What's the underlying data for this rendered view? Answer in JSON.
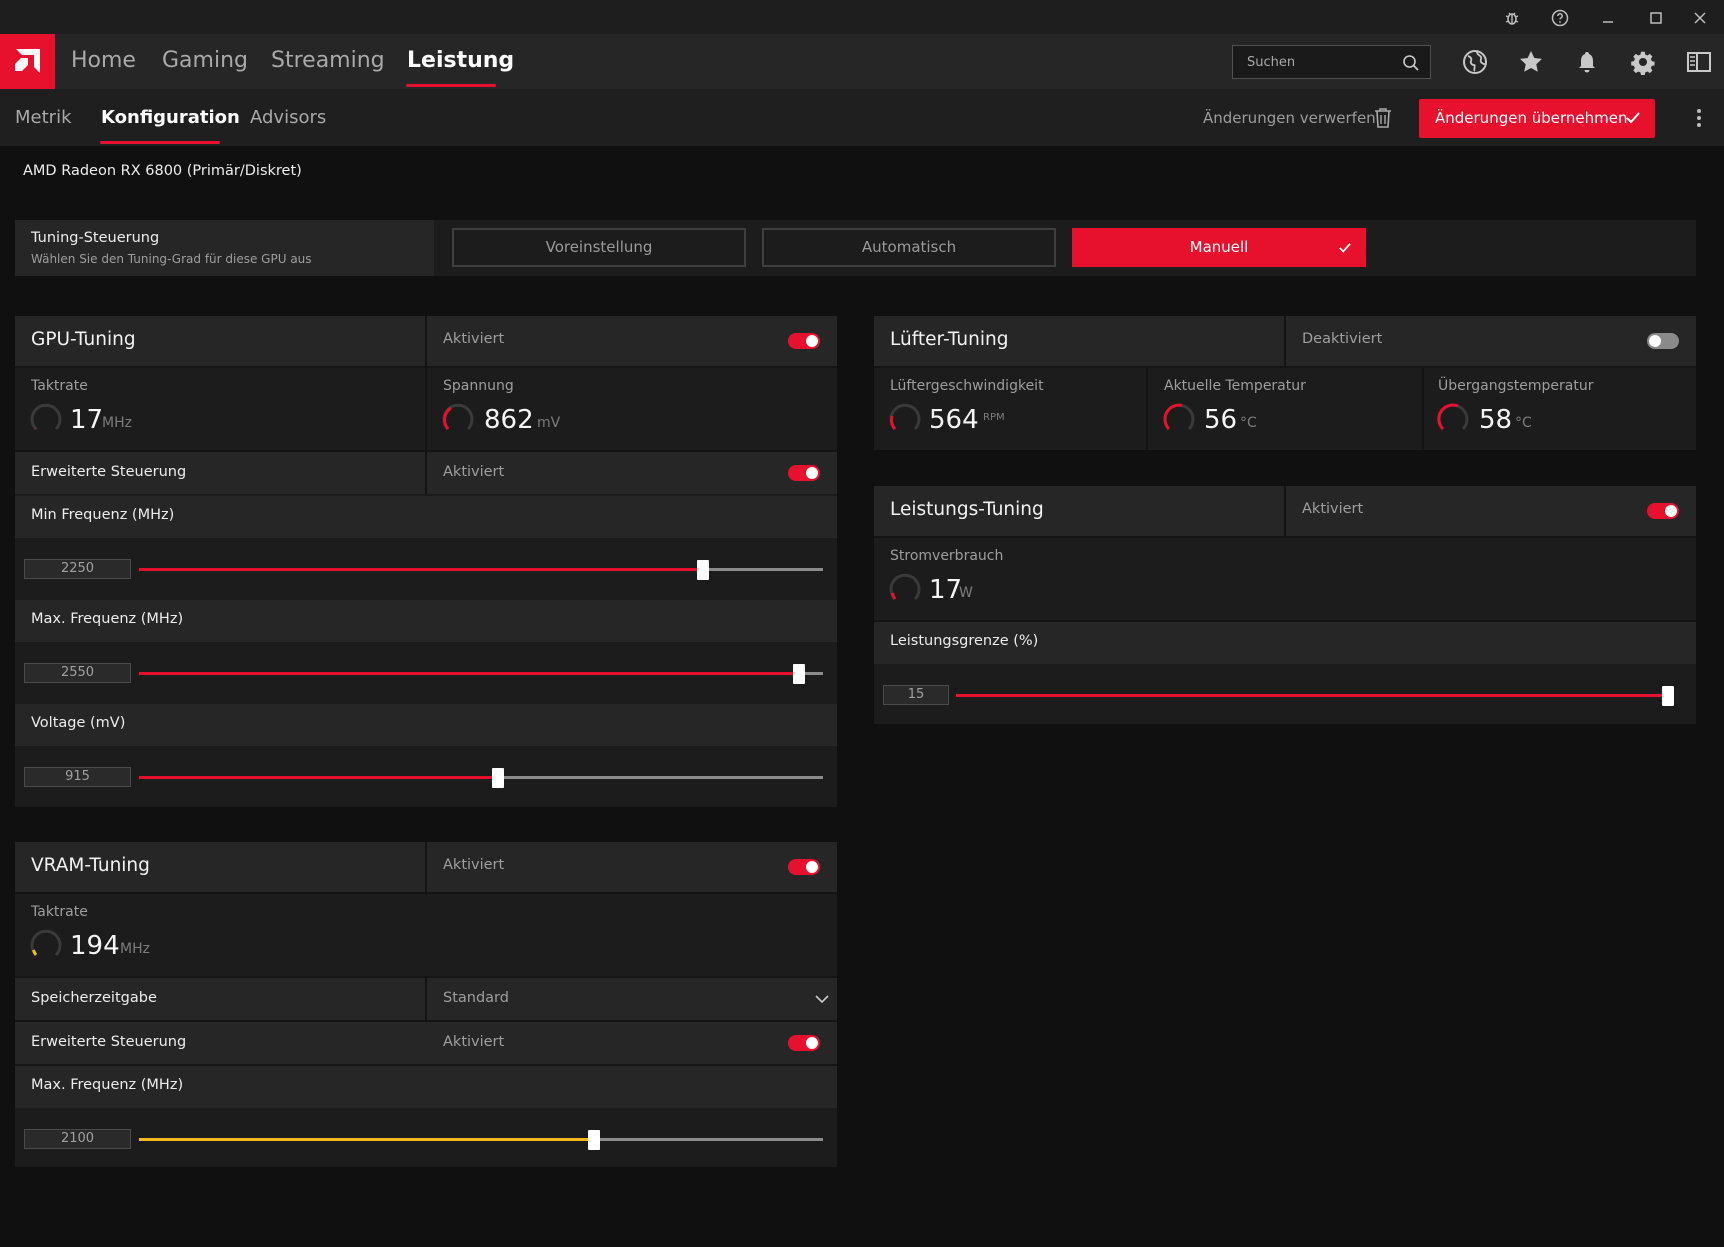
{
  "colors": {
    "accent": "#e8112d",
    "vram_accent": "#f4b81a",
    "background": "#101010",
    "panel": "#1c1c1c",
    "panel_header": "#262626"
  },
  "titlebar": {
    "icons": [
      "bug-icon",
      "help-icon",
      "minimize-icon",
      "maximize-icon",
      "close-icon"
    ]
  },
  "nav": {
    "items": [
      {
        "label": "Home"
      },
      {
        "label": "Gaming"
      },
      {
        "label": "Streaming"
      },
      {
        "label": "Leistung",
        "active": true
      }
    ],
    "search_placeholder": "Suchen",
    "icons": [
      "globe-icon",
      "star-icon",
      "bell-icon",
      "gear-icon",
      "sidebar-toggle-icon"
    ]
  },
  "subnav": {
    "tabs": [
      {
        "label": "Metrik"
      },
      {
        "label": "Konfiguration",
        "active": true
      },
      {
        "label": "Advisors"
      }
    ],
    "discard_label": "Änderungen verwerfen",
    "apply_label": "Änderungen übernehmen"
  },
  "gpu_name": "AMD Radeon RX 6800 (Primär/Diskret)",
  "tuning_control": {
    "title": "Tuning-Steuerung",
    "subtitle": "Wählen Sie den Tuning-Grad für diese GPU aus",
    "options": [
      "Voreinstellung",
      "Automatisch",
      "Manuell"
    ],
    "selected": "Manuell"
  },
  "gpu_tuning": {
    "title": "GPU-Tuning",
    "status": "Aktiviert",
    "enabled": true,
    "clock": {
      "label": "Taktrate",
      "value": "17",
      "unit": "MHz"
    },
    "voltage": {
      "label": "Spannung",
      "value": "862",
      "unit": "mV"
    },
    "advanced": {
      "label": "Erweiterte Steuerung",
      "status": "Aktiviert",
      "enabled": true
    },
    "min_freq": {
      "label": "Min Frequenz (MHz)",
      "value": "2250",
      "fraction": 0.825
    },
    "max_freq": {
      "label": "Max. Frequenz (MHz)",
      "value": "2550",
      "fraction": 0.965
    },
    "voltage_slider": {
      "label": "Voltage (mV)",
      "value": "915",
      "fraction": 0.525
    }
  },
  "vram_tuning": {
    "title": "VRAM-Tuning",
    "status": "Aktiviert",
    "enabled": true,
    "clock": {
      "label": "Taktrate",
      "value": "194",
      "unit": "MHz"
    },
    "memory_timing": {
      "label": "Speicherzeitgabe",
      "value": "Standard"
    },
    "advanced": {
      "label": "Erweiterte Steuerung",
      "status": "Aktiviert",
      "enabled": true
    },
    "max_freq": {
      "label": "Max. Frequenz (MHz)",
      "value": "2100",
      "fraction": 0.665
    }
  },
  "fan_tuning": {
    "title": "Lüfter-Tuning",
    "status": "Deaktiviert",
    "enabled": false,
    "fan_speed": {
      "label": "Lüftergeschwindigkeit",
      "value": "564",
      "unit": "RPM"
    },
    "current_temp": {
      "label": "Aktuelle Temperatur",
      "value": "56",
      "unit": "°C"
    },
    "junction_temp": {
      "label": "Übergangstemperatur",
      "value": "58",
      "unit": "°C"
    }
  },
  "power_tuning": {
    "title": "Leistungs-Tuning",
    "status": "Aktiviert",
    "enabled": true,
    "power_draw": {
      "label": "Stromverbrauch",
      "value": "17",
      "unit": "W"
    },
    "power_limit": {
      "label": "Leistungsgrenze (%)",
      "value": "15",
      "fraction": 1.0
    }
  }
}
